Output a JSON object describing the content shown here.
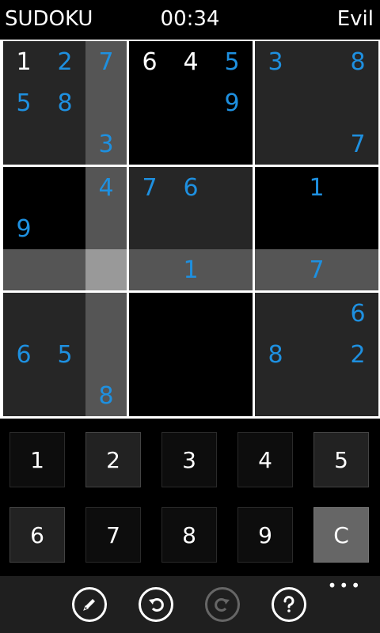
{
  "header": {
    "title": "SUDOKU",
    "timer": "00:34",
    "difficulty": "Evil"
  },
  "board": {
    "cells": [
      [
        "1",
        "2",
        "7",
        "6",
        "4",
        "5",
        "3",
        "",
        "8"
      ],
      [
        "5",
        "8",
        "",
        "",
        "",
        "9",
        "",
        "",
        ""
      ],
      [
        "",
        "",
        "3",
        "",
        "",
        "",
        "",
        "",
        "7"
      ],
      [
        "",
        "",
        "4",
        "7",
        "6",
        "",
        "",
        "1",
        ""
      ],
      [
        "9",
        "",
        "",
        "",
        "",
        "",
        "",
        "",
        ""
      ],
      [
        "",
        "",
        "",
        "",
        "1",
        "",
        "",
        "7",
        ""
      ],
      [
        "",
        "",
        "",
        "",
        "",
        "",
        "",
        "",
        "6"
      ],
      [
        "6",
        "5",
        "",
        "",
        "",
        "",
        "8",
        "",
        "2"
      ],
      [
        "",
        "",
        "8",
        "",
        "",
        "",
        "",
        "",
        ""
      ]
    ],
    "given_cells": [
      [
        0,
        0
      ],
      [
        0,
        3
      ],
      [
        0,
        4
      ]
    ],
    "selected_cell": [
      5,
      2
    ]
  },
  "keypad": {
    "keys": [
      "1",
      "2",
      "3",
      "4",
      "5",
      "6",
      "7",
      "8",
      "9",
      "C"
    ],
    "active_keys": [
      "2",
      "5",
      "6"
    ]
  },
  "appbar": {
    "more_label": "•••",
    "icons": [
      "pencil-icon",
      "undo-icon",
      "redo-icon",
      "help-icon"
    ]
  },
  "colors": {
    "user_digit": "#1e90e0",
    "given_digit": "#ffffff",
    "highlight": "#555555",
    "selected": "#999999"
  }
}
